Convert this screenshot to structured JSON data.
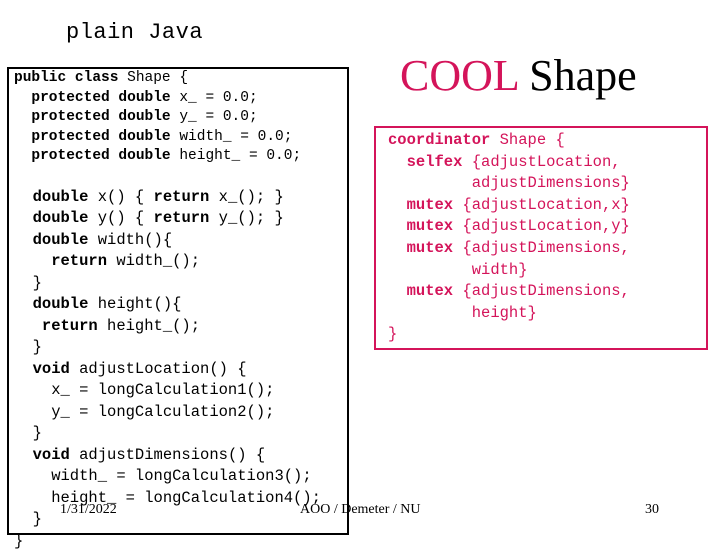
{
  "subtitle": "plain Java",
  "title": {
    "part1": "COOL",
    "part2": " Shape"
  },
  "colors": {
    "accent": "#d4145a",
    "text": "#000000",
    "background": "#ffffff"
  },
  "java_code": {
    "lines": [
      {
        "kw": "public class",
        "rest": " Shape {"
      },
      {
        "kw": "  protected double",
        "rest": " x_ = 0.0;"
      },
      {
        "kw": "  protected double",
        "rest": " y_ = 0.0;"
      },
      {
        "kw": "  protected double",
        "rest": " width_ = 0.0;"
      },
      {
        "kw": "  protected double",
        "rest": " height_ = 0.0;"
      },
      {
        "kw": "",
        "rest": ""
      },
      {
        "kw": "  double",
        "rest": " x() { ",
        "kw2": "return",
        "rest2": " x_(); }"
      },
      {
        "kw": "  double",
        "rest": " y() { ",
        "kw2": "return",
        "rest2": " y_(); }"
      },
      {
        "kw": "  double",
        "rest": " width(){"
      },
      {
        "kw": "    return",
        "rest": " width_();"
      },
      {
        "kw": "",
        "rest": "  }"
      },
      {
        "kw": "  double",
        "rest": " height(){"
      },
      {
        "kw": "   return",
        "rest": " height_();"
      },
      {
        "kw": "",
        "rest": "  }"
      },
      {
        "kw": "  void",
        "rest": " adjustLocation() {"
      },
      {
        "kw": "",
        "rest": "    x_ = longCalculation1();"
      },
      {
        "kw": "",
        "rest": "    y_ = longCalculation2();"
      },
      {
        "kw": "",
        "rest": "  }"
      },
      {
        "kw": "  void",
        "rest": " adjustDimensions() {"
      },
      {
        "kw": "",
        "rest": "    width_ = longCalculation3();"
      },
      {
        "kw": "",
        "rest": "    height_ = longCalculation4();"
      },
      {
        "kw": "",
        "rest": "  }"
      },
      {
        "kw": "",
        "rest": "}"
      }
    ]
  },
  "cool_code": {
    "lines": [
      {
        "kw": "coordinator",
        "rest": " Shape {"
      },
      {
        "kw": "  selfex",
        "rest": " {adjustLocation,"
      },
      {
        "kw": "",
        "rest": "         adjustDimensions}"
      },
      {
        "kw": "  mutex",
        "rest": " {adjustLocation,x}"
      },
      {
        "kw": "  mutex",
        "rest": " {adjustLocation,y}"
      },
      {
        "kw": "  mutex",
        "rest": " {adjustDimensions,"
      },
      {
        "kw": "",
        "rest": "         width}"
      },
      {
        "kw": "  mutex",
        "rest": " {adjustDimensions,"
      },
      {
        "kw": "",
        "rest": "         height}"
      },
      {
        "kw": "",
        "rest": "}"
      }
    ]
  },
  "footer": {
    "date": "1/31/2022",
    "center": "AOO / Demeter / NU",
    "page": "30"
  }
}
